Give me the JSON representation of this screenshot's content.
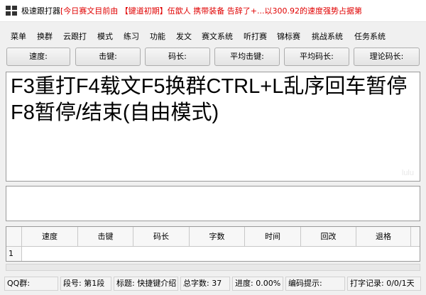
{
  "titlebar": {
    "icon": "grid-app-icon",
    "app_name": "极速跟打器",
    "marquee": "[今日赛文目前由 【键道初期】伍歆人 携带装备 告辞了+...以300.92的速度强势占据第"
  },
  "menu": {
    "items": [
      "菜单",
      "换群",
      "云跟打",
      "模式",
      "练习",
      "功能",
      "发文",
      "赛文系统",
      "听打赛",
      "锦标赛",
      "挑战系统",
      "任务系统"
    ]
  },
  "stats": {
    "buttons": [
      "速度:",
      "击键:",
      "码长:",
      "平均击键:",
      "平均码长:",
      "理论码长:"
    ]
  },
  "text_display": {
    "content": "F3重打F4载文F5换群CTRL+L乱序回车暂停F8暂停/结束(自由模式)",
    "watermark": "lulu"
  },
  "results_grid": {
    "columns": [
      "速度",
      "击键",
      "码长",
      "字数",
      "时间",
      "回改",
      "退格"
    ],
    "row_numbers": [
      "1"
    ]
  },
  "status": {
    "qq_group": "QQ群:",
    "segment": "段号: 第1段",
    "title": "标题: 快捷键介绍",
    "total_chars": "总字数: 37",
    "progress": "进度: 0.00%",
    "hint": "编码提示:",
    "record": "打字记录: 0/0/1天"
  },
  "colors": {
    "marquee_text": "#e00000",
    "window_bg": "#f0f0f0"
  }
}
